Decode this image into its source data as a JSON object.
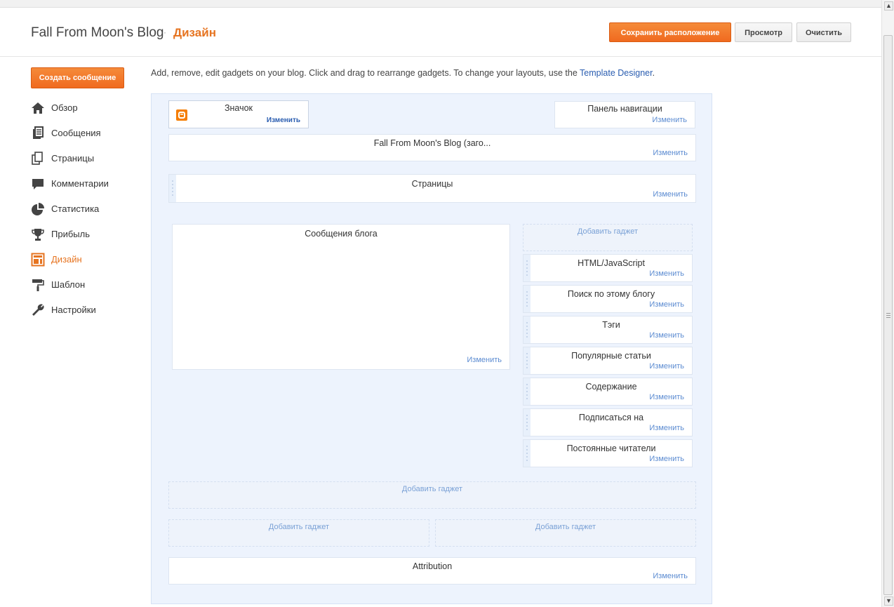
{
  "header": {
    "blog_title": "Fall From Moon's Blog",
    "separator": "·",
    "page_name": "Дизайн",
    "save_label": "Сохранить расположение",
    "preview_label": "Просмотр",
    "clear_label": "Очистить"
  },
  "sidebar": {
    "create_post": "Создать сообщение",
    "items": [
      {
        "label": "Обзор",
        "icon": "home-icon"
      },
      {
        "label": "Сообщения",
        "icon": "posts-icon"
      },
      {
        "label": "Страницы",
        "icon": "pages-icon"
      },
      {
        "label": "Комментарии",
        "icon": "comment-icon"
      },
      {
        "label": "Статистика",
        "icon": "pie-chart-icon"
      },
      {
        "label": "Прибыль",
        "icon": "trophy-icon"
      },
      {
        "label": "Дизайн",
        "icon": "layout-icon",
        "active": true
      },
      {
        "label": "Шаблон",
        "icon": "paint-roller-icon"
      },
      {
        "label": "Настройки",
        "icon": "wrench-icon"
      }
    ]
  },
  "intro": {
    "text": "Add, remove, edit gadgets on your blog. Click and drag to rearrange gadgets. To change your layouts, use the ",
    "link": "Template Designer",
    "end": "."
  },
  "layout": {
    "edit_label": "Изменить",
    "add_gadget_label": "Добавить гаджет",
    "favicon_title": "Значок",
    "navbar_title": "Панель навигации",
    "header_title": "Fall From Moon's Blog (заго...",
    "pages_title": "Страницы",
    "main_title": "Сообщения блога",
    "sidebar_gadgets": [
      "HTML/JavaScript",
      "Поиск по этому блогу",
      "Тэги",
      "Популярные статьи",
      "Содержание",
      "Подписаться на",
      "Постоянные читатели"
    ],
    "attribution_title": "Attribution"
  },
  "colors": {
    "accent": "#e67421",
    "link": "#2a5db0",
    "canvas_bg": "#edf3fd"
  }
}
